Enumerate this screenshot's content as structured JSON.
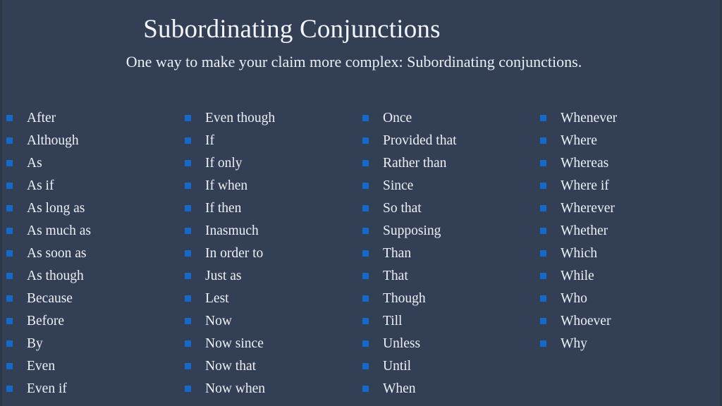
{
  "slide": {
    "title": "Subordinating Conjunctions",
    "subtitle": "One way to make your claim more complex: Subordinating conjunctions.",
    "background_color": "#333f54",
    "bullet_color": "#1569c7",
    "text_color": "#eef0f5",
    "title_color": "#f2f4f8"
  },
  "columns": [
    {
      "index": 0,
      "items": [
        {
          "label": "After"
        },
        {
          "label": "Although"
        },
        {
          "label": "As"
        },
        {
          "label": "As if"
        },
        {
          "label": "As long as"
        },
        {
          "label": "As much as"
        },
        {
          "label": "As soon as"
        },
        {
          "label": "As though"
        },
        {
          "label": "Because"
        },
        {
          "label": "Before"
        },
        {
          "label": "By"
        },
        {
          "label": "Even"
        },
        {
          "label": "Even if"
        }
      ]
    },
    {
      "index": 1,
      "items": [
        {
          "label": "Even though"
        },
        {
          "label": "If"
        },
        {
          "label": "If only"
        },
        {
          "label": "If when"
        },
        {
          "label": "If then"
        },
        {
          "label": "Inasmuch"
        },
        {
          "label": "In order to"
        },
        {
          "label": "Just as"
        },
        {
          "label": "Lest"
        },
        {
          "label": "Now"
        },
        {
          "label": "Now since"
        },
        {
          "label": "Now that"
        },
        {
          "label": "Now when"
        }
      ]
    },
    {
      "index": 2,
      "items": [
        {
          "label": "Once"
        },
        {
          "label": "Provided that"
        },
        {
          "label": "Rather than"
        },
        {
          "label": "Since"
        },
        {
          "label": "So that"
        },
        {
          "label": "Supposing"
        },
        {
          "label": "Than"
        },
        {
          "label": "That"
        },
        {
          "label": "Though"
        },
        {
          "label": "Till"
        },
        {
          "label": "Unless"
        },
        {
          "label": "Until"
        },
        {
          "label": "When"
        }
      ]
    },
    {
      "index": 3,
      "items": [
        {
          "label": "Whenever"
        },
        {
          "label": "Where"
        },
        {
          "label": "Whereas"
        },
        {
          "label": "Where if"
        },
        {
          "label": "Wherever"
        },
        {
          "label": "Whether"
        },
        {
          "label": "Which"
        },
        {
          "label": "While"
        },
        {
          "label": "Who"
        },
        {
          "label": "Whoever"
        },
        {
          "label": "Why"
        }
      ]
    }
  ]
}
